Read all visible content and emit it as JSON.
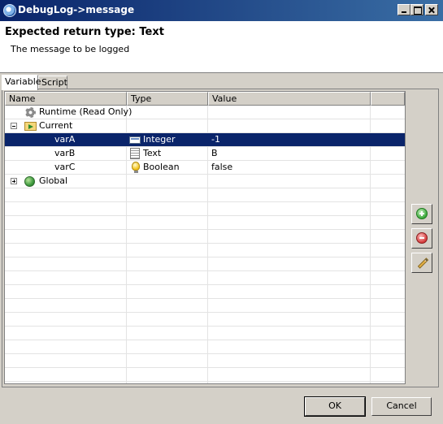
{
  "window": {
    "title": "DebugLog->message"
  },
  "header": {
    "heading": "Expected return type: Text",
    "description": "The message to be logged"
  },
  "tabs": [
    {
      "label": "Variable",
      "active": true
    },
    {
      "label": "Script",
      "active": false
    }
  ],
  "table": {
    "columns": [
      "Name",
      "Type",
      "Value"
    ],
    "rows": [
      {
        "name": "Runtime (Read Only)",
        "type": "",
        "value": "",
        "icon": "gear-icon",
        "expander": ""
      },
      {
        "name": "Current",
        "type": "",
        "value": "",
        "icon": "folder-icon",
        "expander": "collapse"
      },
      {
        "name": "varA",
        "type": "Integer",
        "value": "-1",
        "type_icon": "integer-icon",
        "selected": true
      },
      {
        "name": "varB",
        "type": "Text",
        "value": "B",
        "type_icon": "text-icon"
      },
      {
        "name": "varC",
        "type": "Boolean",
        "value": "false",
        "type_icon": "boolean-icon"
      },
      {
        "name": "Global",
        "type": "",
        "value": "",
        "icon": "globe-icon",
        "expander": "expand"
      }
    ]
  },
  "side_buttons": [
    {
      "icon": "add-icon"
    },
    {
      "icon": "remove-icon"
    },
    {
      "icon": "edit-icon"
    }
  ],
  "footer": {
    "ok_label": "OK",
    "cancel_label": "Cancel"
  },
  "colors": {
    "titlebar_start": "#0a246a",
    "titlebar_end": "#3a6ea5",
    "selection": "#0a246a",
    "dialog_bg": "#d4d0c8"
  }
}
